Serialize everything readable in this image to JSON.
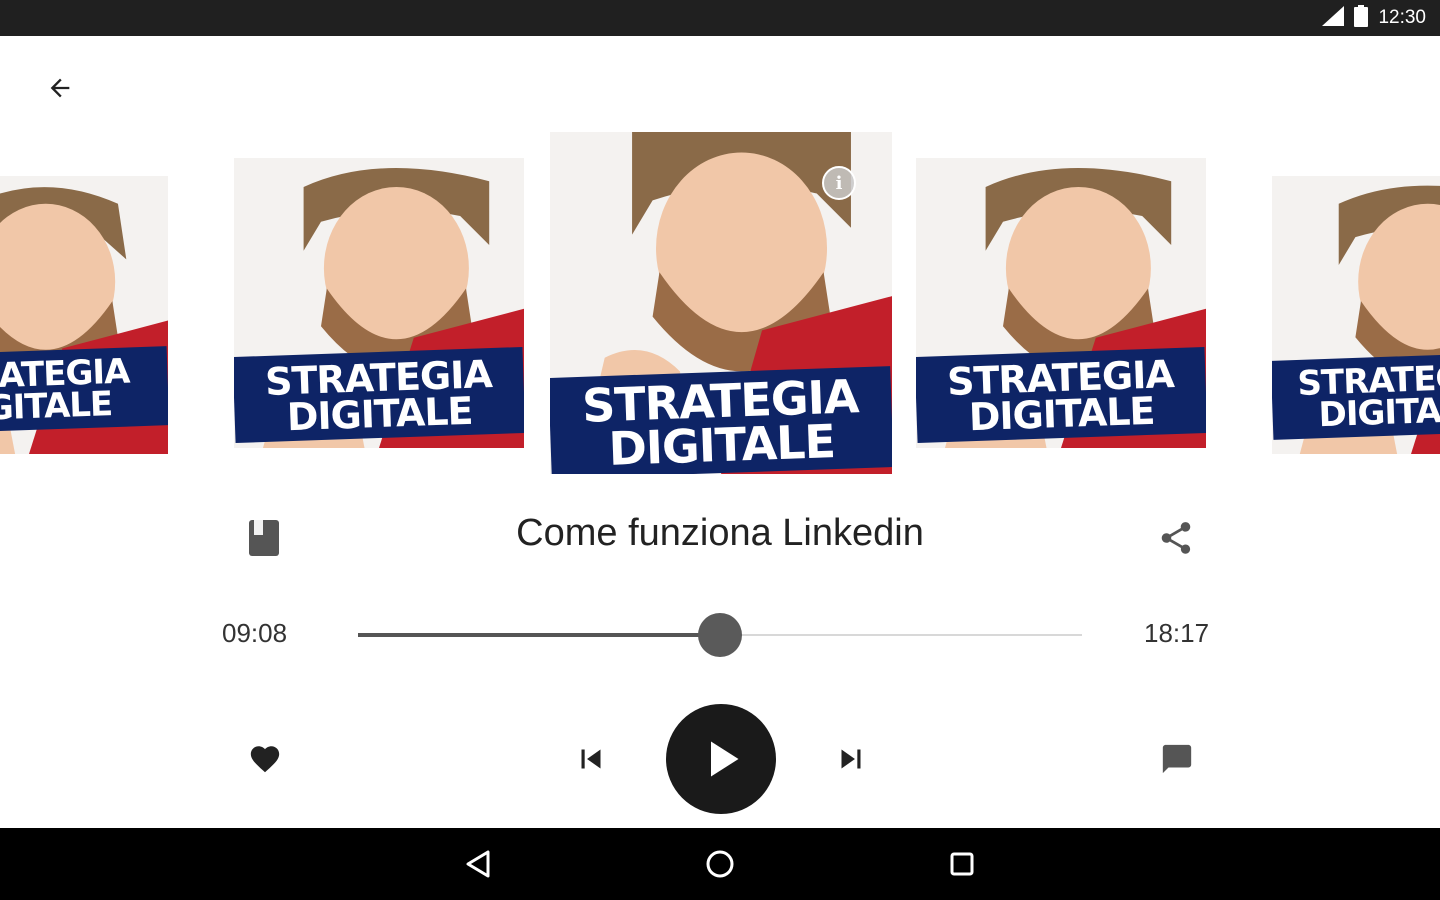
{
  "status_bar": {
    "time": "12:30"
  },
  "covers": [
    {
      "line1": "STRATEGIA",
      "line2": "DIGITALE"
    },
    {
      "line1": "STRATEGIA",
      "line2": "DIGITALE"
    },
    {
      "line1": "STRATEGIA",
      "line2": "DIGITALE"
    },
    {
      "line1": "STRATEGIA",
      "line2": "DIGITALE"
    },
    {
      "line1": "STRATEGIA",
      "line2": "DIGITALE"
    }
  ],
  "player": {
    "episode_title": "Come funziona Linkedin",
    "elapsed": "09:08",
    "duration": "18:17",
    "progress": 0.5
  },
  "icons": {
    "back": "arrow-left-icon",
    "info": "info-icon",
    "chapters": "book-icon",
    "share": "share-icon",
    "favorite": "heart-icon",
    "previous": "skip-previous-icon",
    "play": "play-icon",
    "next": "skip-next-icon",
    "comments": "comment-icon"
  },
  "colors": {
    "banner": "#0e2466",
    "play_button": "#1a1a1a",
    "seek_fill": "#555555"
  }
}
